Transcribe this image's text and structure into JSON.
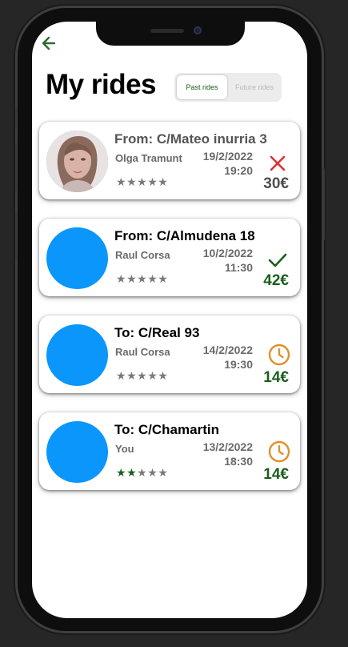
{
  "header": {
    "title": "My rides"
  },
  "tabs": [
    {
      "label": "Past rides",
      "active": true
    },
    {
      "label": "Future rides",
      "active": false
    }
  ],
  "rides": [
    {
      "route": "From: C/Mateo inurria 3",
      "driver": "Olga Tramunt",
      "date": "19/2/2022",
      "time": "19:20",
      "rating": 0,
      "status": "cancelled",
      "status_icon": "close-icon",
      "price": "30€",
      "price_color": "#4d4d4d",
      "route_color": "#555555",
      "avatar": "photo"
    },
    {
      "route": "From: C/Almudena 18",
      "driver": "Raul Corsa",
      "date": "10/2/2022",
      "time": "11:30",
      "rating": 0,
      "status": "completed",
      "status_icon": "check-icon",
      "price": "42€",
      "price_color": "#1c5e1c",
      "route_color": "#000000",
      "avatar": "placeholder"
    },
    {
      "route": "To: C/Real 93",
      "driver": "Raul Corsa",
      "date": "14/2/2022",
      "time": "19:30",
      "rating": 0,
      "status": "pending",
      "status_icon": "clock-icon",
      "price": "14€",
      "price_color": "#1c5e1c",
      "route_color": "#000000",
      "avatar": "placeholder"
    },
    {
      "route": "To: C/Chamartin",
      "driver": "You",
      "date": "13/2/2022",
      "time": "18:30",
      "rating": 2,
      "status": "pending",
      "status_icon": "clock-icon",
      "price": "14€",
      "price_color": "#1c5e1c",
      "route_color": "#000000",
      "avatar": "placeholder"
    }
  ],
  "colors": {
    "accent_green": "#1c5e1c",
    "cancel_red": "#e03030",
    "pending_orange": "#e0902a",
    "avatar_blue": "#0a96fb"
  }
}
